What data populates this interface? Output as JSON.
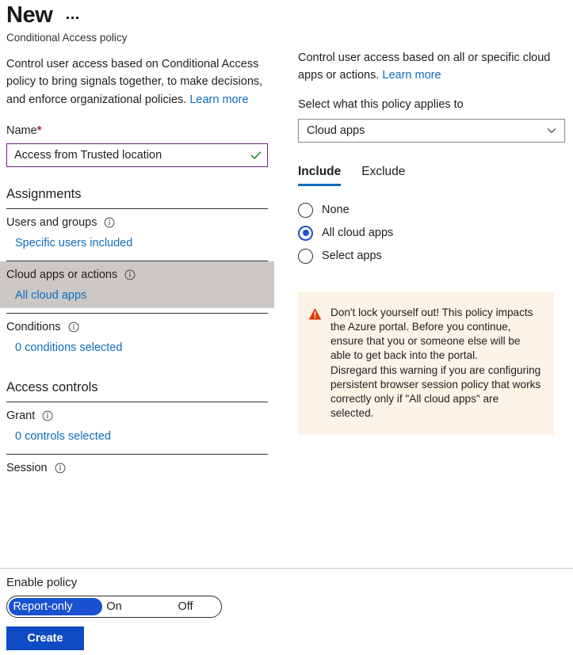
{
  "header": {
    "title": "New",
    "overflow_menu": "ellipsis-menu",
    "subtitle": "Conditional Access policy",
    "intro_text": "Control user access based on Conditional Access policy to bring signals together, to make decisions, and enforce organizational policies.",
    "intro_link": "Learn more"
  },
  "name_field": {
    "label": "Name",
    "required_marker": "*",
    "value": "Access from Trusted location",
    "placeholder": "",
    "validation_icon": "check-icon",
    "border_color": "#68217a",
    "check_color": "#107c10"
  },
  "assignments": {
    "heading": "Assignments",
    "rows": [
      {
        "title": "Users and groups",
        "value": "Specific users included",
        "selected": false,
        "info_icon": "info-icon"
      },
      {
        "title": "Cloud apps or actions",
        "value": "All cloud apps",
        "selected": true,
        "info_icon": "info-icon"
      },
      {
        "title": "Conditions",
        "value": "0 conditions selected",
        "selected": false,
        "info_icon": "info-icon"
      }
    ]
  },
  "access_controls": {
    "heading": "Access controls",
    "rows": [
      {
        "title": "Grant",
        "value": "0 controls selected",
        "selected": false,
        "info_icon": "info-icon"
      },
      {
        "title": "Session",
        "value": "",
        "selected": false,
        "info_icon": "info-icon"
      }
    ]
  },
  "enable_policy": {
    "label": "Enable policy",
    "options": [
      "Report-only",
      "On",
      "Off"
    ],
    "selected": "Report-only",
    "selected_bg": "#1a51d1"
  },
  "footer": {
    "create_label": "Create",
    "create_bg": "#0f4bc4"
  },
  "detail_panel": {
    "intro_text": "Control user access based on all or specific cloud apps or actions.",
    "intro_link": "Learn more",
    "select_label": "Select what this policy applies to",
    "select_value": "Cloud apps",
    "select_chevron": "chevron-down-icon",
    "tabs": [
      {
        "label": "Include",
        "active": true
      },
      {
        "label": "Exclude",
        "active": false
      }
    ],
    "radio_options": [
      {
        "label": "None",
        "checked": false
      },
      {
        "label": "All cloud apps",
        "checked": true
      },
      {
        "label": "Select apps",
        "checked": false
      }
    ],
    "warning": {
      "icon": "warning-triangle-icon",
      "icon_color": "#d83b01",
      "background": "#fdf3e7",
      "paragraph_1": "Don't lock yourself out! This policy impacts the Azure portal. Before you continue, ensure that you or someone else will be able to get back into the portal.",
      "paragraph_2": "Disregard this warning if you are configuring persistent browser session policy that works correctly only if \"All cloud apps\" are selected."
    }
  }
}
